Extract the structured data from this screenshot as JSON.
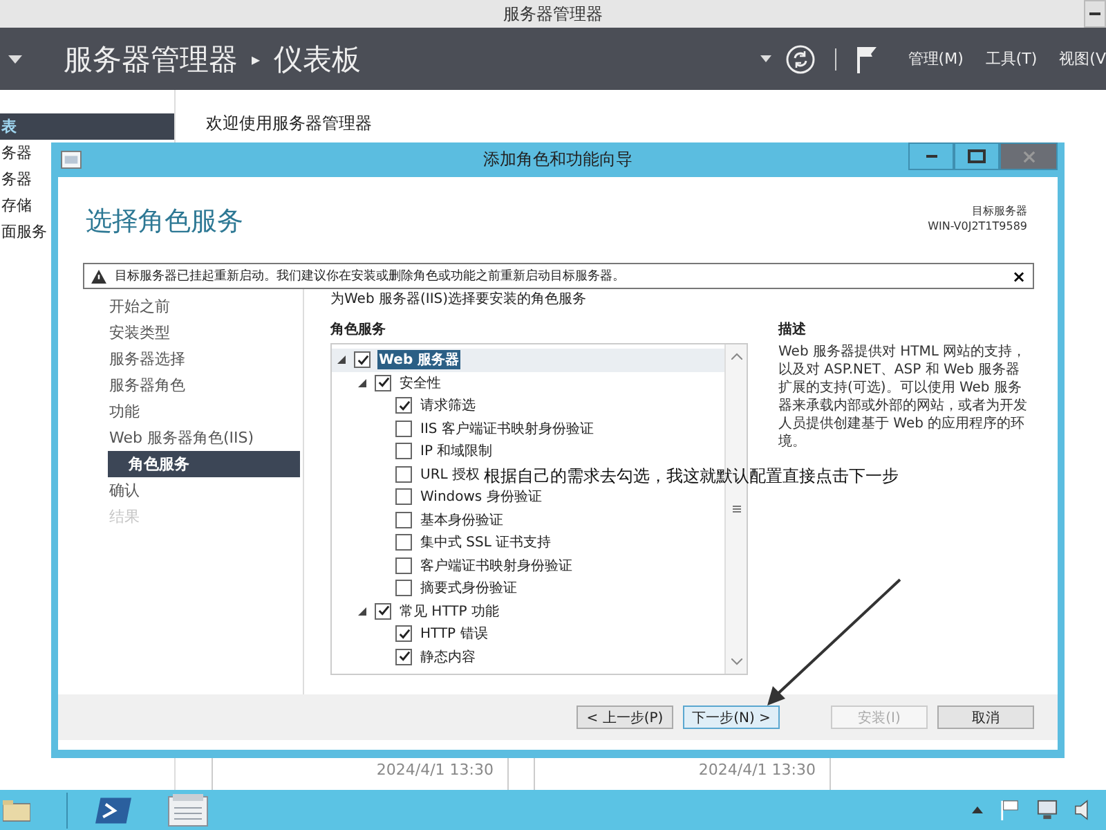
{
  "window": {
    "title": "服务器管理器"
  },
  "header": {
    "crumbs": [
      "服务器管理器",
      "仪表板"
    ],
    "separator": "▸",
    "menus": [
      "管理(M)",
      "工具(T)",
      "视图(V"
    ]
  },
  "sidebar": {
    "items": [
      {
        "label": "表",
        "selected": true
      },
      {
        "label": "务器",
        "selected": false
      },
      {
        "label": "务器",
        "selected": false
      },
      {
        "label": "存储",
        "selected": false
      },
      {
        "label": "面服务",
        "selected": false
      }
    ]
  },
  "welcome": "欢迎使用服务器管理器",
  "tiles": [
    {
      "time": "2024/4/1 13:30"
    },
    {
      "time": "2024/4/1 13:30"
    }
  ],
  "dialog": {
    "title": "添加角色和功能向导",
    "heading": "选择角色服务",
    "target_label": "目标服务器",
    "target_server": "WIN-V0J2T1T9589",
    "warning": "目标服务器已挂起重新启动。我们建议你在安装或删除角色或功能之前重新启动目标服务器。",
    "warning_close": "×",
    "nav": [
      {
        "label": "开始之前",
        "selected": false,
        "disabled": false
      },
      {
        "label": "安装类型",
        "selected": false,
        "disabled": false
      },
      {
        "label": "服务器选择",
        "selected": false,
        "disabled": false
      },
      {
        "label": "服务器角色",
        "selected": false,
        "disabled": false
      },
      {
        "label": "功能",
        "selected": false,
        "disabled": false
      },
      {
        "label": "Web 服务器角色(IIS)",
        "selected": false,
        "disabled": false
      },
      {
        "label": "角色服务",
        "selected": true,
        "disabled": false
      },
      {
        "label": "确认",
        "selected": false,
        "disabled": false
      },
      {
        "label": "结果",
        "selected": false,
        "disabled": true
      }
    ],
    "subtitle": "为Web 服务器(IIS)选择要安装的角色服务",
    "tree_label": "角色服务",
    "tree": [
      {
        "label": "Web 服务器",
        "checked": true,
        "expanded": true,
        "selected": true,
        "children": [
          {
            "label": "安全性",
            "checked": true,
            "expanded": true,
            "selected": false,
            "children": [
              {
                "label": "请求筛选",
                "checked": true,
                "selected": false
              },
              {
                "label": "IIS 客户端证书映射身份验证",
                "checked": false,
                "selected": false
              },
              {
                "label": "IP 和域限制",
                "checked": false,
                "selected": false
              },
              {
                "label": "URL 授权",
                "checked": false,
                "selected": false
              },
              {
                "label": "Windows 身份验证",
                "checked": false,
                "selected": false
              },
              {
                "label": "基本身份验证",
                "checked": false,
                "selected": false
              },
              {
                "label": "集中式 SSL 证书支持",
                "checked": false,
                "selected": false
              },
              {
                "label": "客户端证书映射身份验证",
                "checked": false,
                "selected": false
              },
              {
                "label": "摘要式身份验证",
                "checked": false,
                "selected": false
              }
            ]
          },
          {
            "label": "常见 HTTP 功能",
            "checked": true,
            "expanded": true,
            "selected": false,
            "children": [
              {
                "label": "HTTP 错误",
                "checked": true,
                "selected": false
              },
              {
                "label": "静态内容",
                "checked": true,
                "selected": false
              }
            ]
          }
        ]
      }
    ],
    "description_label": "描述",
    "description": "Web 服务器提供对 HTML 网站的支持，以及对 ASP.NET、ASP 和 Web 服务器扩展的支持(可选)。可以使用 Web 服务器来承载内部或外部的网站，或者为开发人员提供创建基于 Web 的应用程序的环境。",
    "buttons": [
      {
        "label": "< 上一步(P)",
        "kind": "normal",
        "disabled": false,
        "default": false
      },
      {
        "label": "下一步(N) >",
        "kind": "normal",
        "disabled": false,
        "default": true
      },
      {
        "label": "安装(I)",
        "kind": "gap",
        "disabled": true,
        "default": false
      },
      {
        "label": "取消",
        "kind": "normal",
        "disabled": false,
        "default": false
      }
    ]
  },
  "annotation": "根据自己的需求去勾选，我这就默认配置直接点击下一步"
}
